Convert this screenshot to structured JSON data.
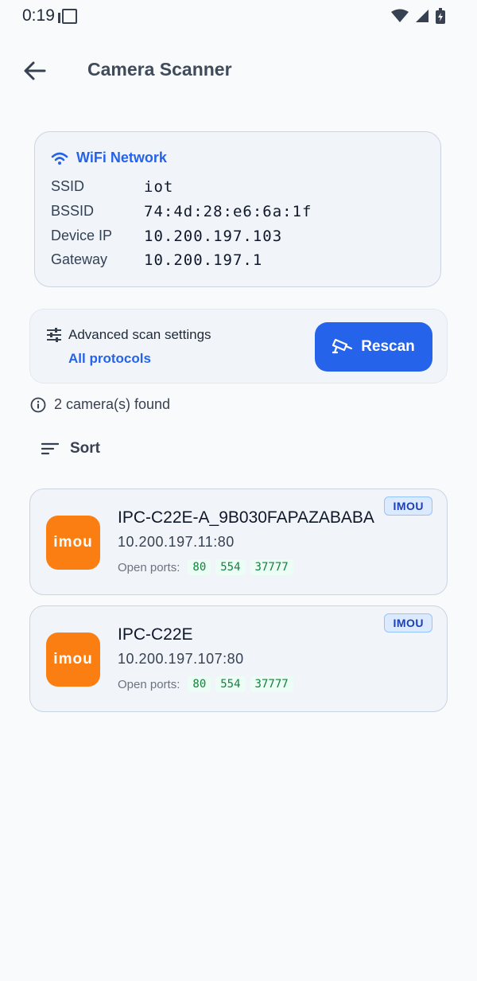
{
  "status": {
    "time": "0:19"
  },
  "appbar": {
    "title": "Camera Scanner"
  },
  "wifi": {
    "header": "WiFi Network",
    "rows": [
      {
        "label": "SSID",
        "value": "iot"
      },
      {
        "label": "BSSID",
        "value": "74:4d:28:e6:6a:1f"
      },
      {
        "label": "Device IP",
        "value": "10.200.197.103"
      },
      {
        "label": "Gateway",
        "value": "10.200.197.1"
      }
    ]
  },
  "advanced": {
    "label": "Advanced scan settings",
    "sub": "All protocols",
    "button": "Rescan"
  },
  "found_text": "2 camera(s) found",
  "sort_label": "Sort",
  "ports_label": "Open ports:",
  "cameras": [
    {
      "name": "IPC-C22E-A_9B030FAPAZABABA",
      "address": "10.200.197.11:80",
      "brand": "IMOU",
      "logo": "imou",
      "ports": [
        "80",
        "554",
        "37777"
      ]
    },
    {
      "name": "IPC-C22E",
      "address": "10.200.197.107:80",
      "brand": "IMOU",
      "logo": "imou",
      "ports": [
        "80",
        "554",
        "37777"
      ]
    }
  ],
  "colors": {
    "accent": "#2563eb",
    "brand_orange": "#fb7e12",
    "port_green": "#15803d"
  }
}
